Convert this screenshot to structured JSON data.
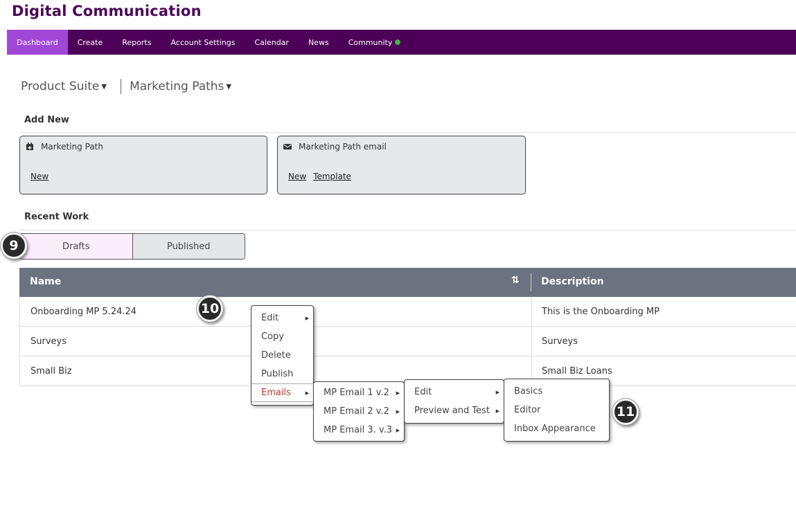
{
  "app": {
    "title": "Digital Communication"
  },
  "nav": {
    "items": [
      {
        "label": "Dashboard",
        "active": true
      },
      {
        "label": "Create"
      },
      {
        "label": "Reports"
      },
      {
        "label": "Account Settings"
      },
      {
        "label": "Calendar"
      },
      {
        "label": "News"
      },
      {
        "label": "Community",
        "status_color": "#3db83d"
      }
    ]
  },
  "breadcrumb": {
    "product": "Product Suite",
    "section": "Marketing Paths"
  },
  "add_new": {
    "title": "Add New",
    "cards": [
      {
        "title": "Marketing Path",
        "icon": "calendar-plus-icon",
        "links": [
          "New"
        ]
      },
      {
        "title": "Marketing Path email",
        "icon": "envelope-icon",
        "links": [
          "New",
          "Template"
        ]
      }
    ]
  },
  "recent_work": {
    "title": "Recent Work",
    "tabs": [
      {
        "label": "Drafts",
        "active": true
      },
      {
        "label": "Published"
      }
    ]
  },
  "table": {
    "columns": [
      "Name",
      "Description"
    ],
    "rows": [
      {
        "name": "Onboarding MP 5.24.24",
        "description": "This is the Onboarding MP"
      },
      {
        "name": "Surveys",
        "description": "Surveys"
      },
      {
        "name": "Small Biz",
        "description": "Small Biz Loans"
      }
    ]
  },
  "context_menu": {
    "items": [
      "Edit",
      "Copy",
      "Delete",
      "Publish",
      "Emails"
    ],
    "emails_submenu": [
      "MP Email 1 v.2",
      "MP Email 2 v.2",
      "MP Email 3. v.3"
    ],
    "email_actions": [
      "Edit",
      "Preview and Test"
    ],
    "edit_actions": [
      "Basics",
      "Editor",
      "Inbox Appearance"
    ]
  },
  "callouts": [
    "9",
    "10",
    "11"
  ]
}
